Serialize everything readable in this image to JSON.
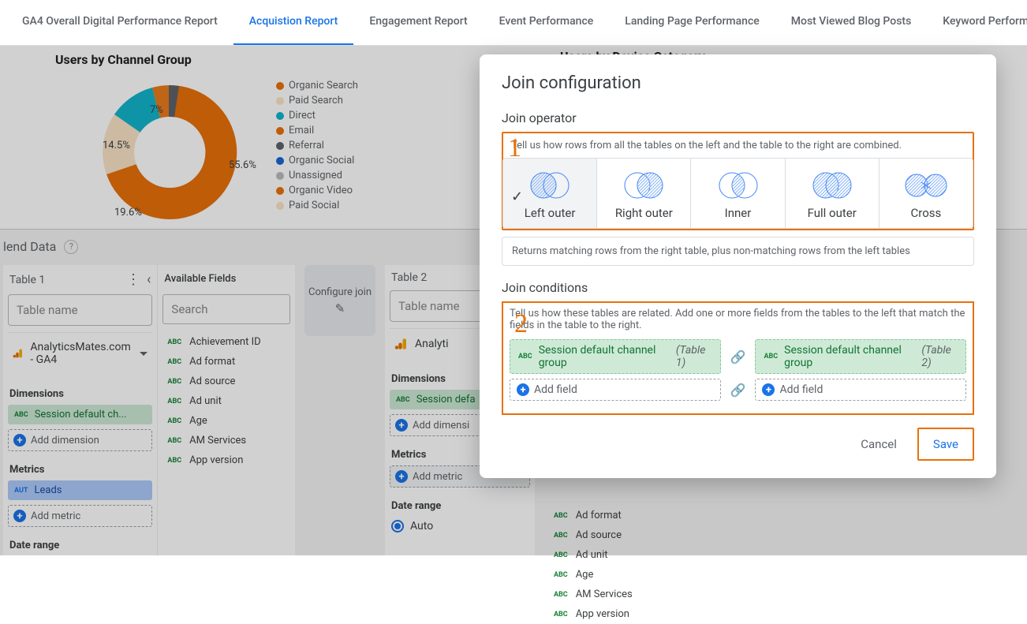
{
  "tabs": [
    {
      "label": "GA4 Overall Digital Performance Report",
      "active": false
    },
    {
      "label": "Acquistion Report",
      "active": true
    },
    {
      "label": "Engagement Report",
      "active": false
    },
    {
      "label": "Event Performance",
      "active": false
    },
    {
      "label": "Landing Page Performance",
      "active": false
    },
    {
      "label": "Most Viewed Blog Posts",
      "active": false
    },
    {
      "label": "Keyword Performance",
      "active": false
    }
  ],
  "charts": {
    "left_title": "Users by Channel Group",
    "right_title": "Users by Device Category",
    "legend": [
      {
        "label": "Organic Search",
        "color": "#e8710a"
      },
      {
        "label": "Paid Search",
        "color": "#f9e3c6"
      },
      {
        "label": "Direct",
        "color": "#12b5cb"
      },
      {
        "label": "Email",
        "color": "#e8710a"
      },
      {
        "label": "Referral",
        "color": "#5f6368"
      },
      {
        "label": "Organic Social",
        "color": "#1967d2"
      },
      {
        "label": "Unassigned",
        "color": "#bbbbbb"
      },
      {
        "label": "Organic Video",
        "color": "#e8710a"
      },
      {
        "label": "Paid Social",
        "color": "#f9e3c6"
      }
    ],
    "slice_labels": [
      "55.6%",
      "19.6%",
      "14.5%",
      "7%"
    ]
  },
  "chart_data": {
    "type": "pie",
    "title": "Users by Channel Group",
    "categories": [
      "Organic Search",
      "Paid Search",
      "Direct",
      "Email",
      "Referral",
      "Organic Social",
      "Unassigned",
      "Organic Video",
      "Paid Social"
    ],
    "values": [
      55.6,
      19.6,
      14.5,
      7.0,
      1.3,
      1.0,
      0.5,
      0.3,
      0.2
    ],
    "colors": [
      "#e8710a",
      "#f9e3c6",
      "#12b5cb",
      "#e8710a",
      "#5f6368",
      "#1967d2",
      "#bbbbbb",
      "#e8710a",
      "#f9e3c6"
    ]
  },
  "blend": {
    "title": "lend Data",
    "table1_label": "Table 1",
    "table2_label": "Table 2",
    "name_placeholder": "Table name",
    "datasource": "AnalyticsMates.com - GA4",
    "dimensions_label": "Dimensions",
    "dim_chip": "Session default ch...",
    "dim_chip2": "Session defa",
    "add_dimension": "Add dimension",
    "add_dimension2": "Add dimensi",
    "metrics_label": "Metrics",
    "metric_chip": "Leads",
    "add_metric": "Add metric",
    "date_range_label": "Date range",
    "auto_label": "Auto",
    "available_fields_label": "Available Fields",
    "search_placeholder": "Search",
    "fields": [
      "Achievement ID",
      "Ad format",
      "Ad source",
      "Ad unit",
      "Age",
      "AM Services",
      "App version"
    ],
    "fields_r": [
      "Ad format",
      "Ad source",
      "Ad unit",
      "Age",
      "AM Services",
      "App version"
    ],
    "configure_join": "Configure join"
  },
  "modal": {
    "title": "Join configuration",
    "operator_h": "Join operator",
    "operator_desc": "Tell us how rows from all the tables on the left and the table to the right are combined.",
    "operators": [
      {
        "label": "Left outer",
        "selected": true
      },
      {
        "label": "Right outer",
        "selected": false
      },
      {
        "label": "Inner",
        "selected": false
      },
      {
        "label": "Full outer",
        "selected": false
      },
      {
        "label": "Cross",
        "selected": false
      }
    ],
    "result_desc": "Returns matching rows from the right table, plus non-matching rows from the left tables",
    "conditions_h": "Join conditions",
    "conditions_desc": "Tell us how these tables are related. Add one or more fields from the tables to the left that match the fields in the table to the right.",
    "cond_left": {
      "field": "Session default channel group",
      "table": "(Table 1)"
    },
    "cond_right": {
      "field": "Session default channel group",
      "table": "(Table 2)"
    },
    "add_field": "Add field",
    "cancel": "Cancel",
    "save": "Save"
  }
}
